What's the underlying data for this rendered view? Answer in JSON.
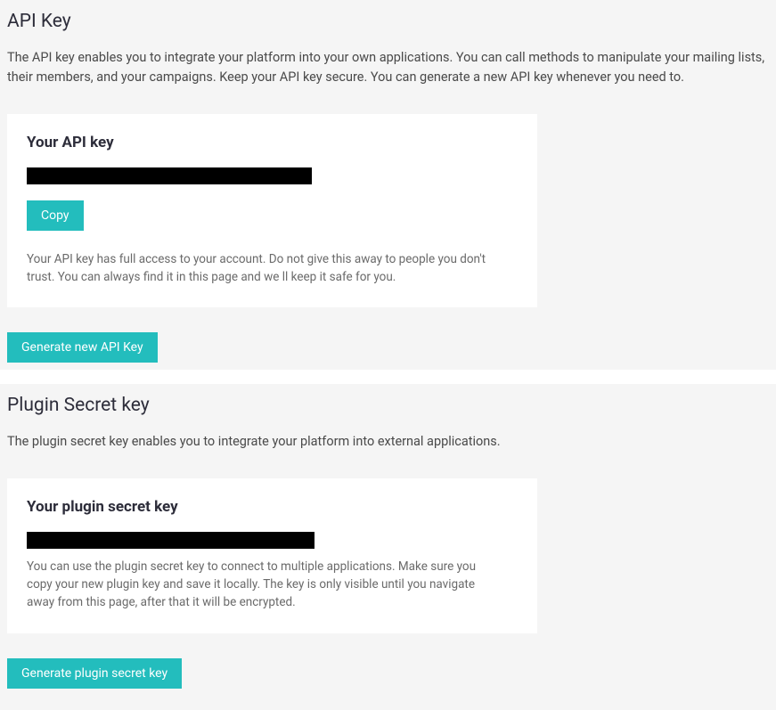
{
  "api_section": {
    "title": "API Key",
    "description": "The API key enables you to integrate your platform into your own applications. You can call methods to manipulate your mailing lists, their members, and your campaigns. Keep your API key secure. You can generate a new API key whenever you need to.",
    "card": {
      "title": "Your API key",
      "copy_button": "Copy",
      "note": "Your API key has full access to your account. Do not give this away to people you don't trust. You can always find it in this page and we ll keep it safe for you."
    },
    "generate_button": "Generate new API Key"
  },
  "plugin_section": {
    "title": "Plugin Secret key",
    "description": "The plugin secret key enables you to integrate your platform into external applications.",
    "card": {
      "title": "Your plugin secret key",
      "note": "You can use the plugin secret key to connect to multiple applications. Make sure you copy your new plugin key and save it locally. The key is only visible until you navigate away from this page, after that it will be encrypted."
    },
    "generate_button": "Generate plugin secret key"
  }
}
